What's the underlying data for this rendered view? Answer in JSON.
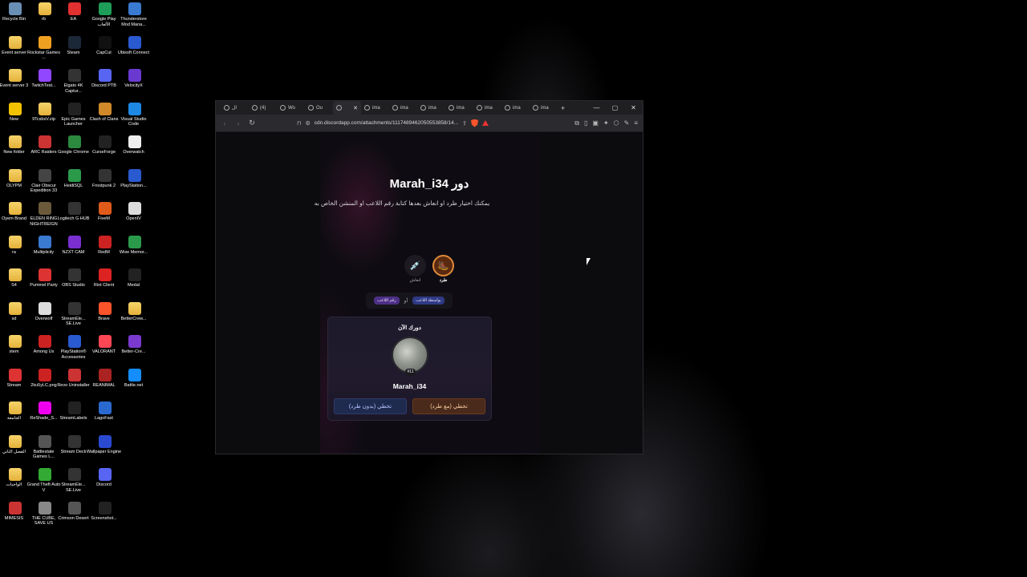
{
  "desktop": {
    "icons": [
      {
        "label": "Recycle Bin",
        "col": 0,
        "row": 0,
        "icon": "recycle-bin-icon",
        "color": "#6a8fb5"
      },
      {
        "label": "Event server",
        "col": 0,
        "row": 1,
        "icon": "folder-icon",
        "color": "folder"
      },
      {
        "label": "Event server 3",
        "col": 0,
        "row": 2,
        "icon": "folder-icon",
        "color": "folder"
      },
      {
        "label": "New",
        "col": 0,
        "row": 3,
        "icon": "warning-icon",
        "color": "#f2c200"
      },
      {
        "label": "New folder",
        "col": 0,
        "row": 4,
        "icon": "folder-icon",
        "color": "folder"
      },
      {
        "label": "OLYPM",
        "col": 0,
        "row": 5,
        "icon": "folder-icon",
        "color": "folder"
      },
      {
        "label": "Oyem Brand",
        "col": 0,
        "row": 6,
        "icon": "folder-icon",
        "color": "folder"
      },
      {
        "label": "ra",
        "col": 0,
        "row": 7,
        "icon": "folder-icon",
        "color": "folder"
      },
      {
        "label": "S4",
        "col": 0,
        "row": 8,
        "icon": "folder-icon",
        "color": "folder"
      },
      {
        "label": "sd",
        "col": 0,
        "row": 9,
        "icon": "folder-icon",
        "color": "folder"
      },
      {
        "label": "stem",
        "col": 0,
        "row": 10,
        "icon": "folder-icon",
        "color": "folder"
      },
      {
        "label": "Stream",
        "col": 0,
        "row": 11,
        "icon": "x-icon",
        "color": "#d33"
      },
      {
        "label": "الجامعة",
        "col": 0,
        "row": 12,
        "icon": "folder-icon",
        "color": "folder"
      },
      {
        "label": "الفصل الثاني",
        "col": 0,
        "row": 13,
        "icon": "folder-icon",
        "color": "folder"
      },
      {
        "label": "الواجبات",
        "col": 0,
        "row": 14,
        "icon": "folder-icon",
        "color": "folder"
      },
      {
        "label": "MIMESIS",
        "col": 0,
        "row": 15,
        "icon": "mimesis-icon",
        "color": "#c33"
      },
      {
        "label": "rb",
        "col": 1,
        "row": 0,
        "icon": "folder-icon",
        "color": "folder"
      },
      {
        "label": "Rockstar Games ...",
        "col": 1,
        "row": 1,
        "icon": "rockstar-icon",
        "color": "#f0a020"
      },
      {
        "label": "TwitchTest...",
        "col": 1,
        "row": 2,
        "icon": "twitch-icon",
        "color": "#9146ff"
      },
      {
        "label": "9TcsbsV.zip",
        "col": 1,
        "row": 3,
        "icon": "zip-folder-icon",
        "color": "folder"
      },
      {
        "label": "ARC Raiders",
        "col": 1,
        "row": 4,
        "icon": "arc-raiders-icon",
        "color": "#c33"
      },
      {
        "label": "Clair Obscur Expedition 33",
        "col": 1,
        "row": 5,
        "icon": "clair-obscur-icon",
        "color": "#444"
      },
      {
        "label": "ELDEN RING NIGHTREIGN",
        "col": 1,
        "row": 6,
        "icon": "elden-ring-icon",
        "color": "#6a5a3a"
      },
      {
        "label": "Multiplicity",
        "col": 1,
        "row": 7,
        "icon": "multiplicity-icon",
        "color": "#3a7ad0"
      },
      {
        "label": "Pummel Party",
        "col": 1,
        "row": 8,
        "icon": "pummel-party-icon",
        "color": "#d33"
      },
      {
        "label": "Overwolf",
        "col": 1,
        "row": 9,
        "icon": "overwolf-icon",
        "color": "#ddd"
      },
      {
        "label": "Among Us",
        "col": 1,
        "row": 10,
        "icon": "among-us-icon",
        "color": "#c22"
      },
      {
        "label": "2ku5yLC.png",
        "col": 1,
        "row": 11,
        "icon": "image-file-icon",
        "color": "#c22"
      },
      {
        "label": "ReShade_S...",
        "col": 1,
        "row": 12,
        "icon": "reshade-icon",
        "color": "#e0e"
      },
      {
        "label": "Battlestate Games L...",
        "col": 1,
        "row": 13,
        "icon": "battlestate-icon",
        "color": "#555"
      },
      {
        "label": "Grand Theft Auto V",
        "col": 1,
        "row": 14,
        "icon": "gta-icon",
        "color": "#3a3"
      },
      {
        "label": "THE CUBE, SAVE US",
        "col": 1,
        "row": 15,
        "icon": "the-cube-icon",
        "color": "#888"
      },
      {
        "label": "EA",
        "col": 2,
        "row": 0,
        "icon": "ea-icon",
        "color": "#e03030"
      },
      {
        "label": "Steam",
        "col": 2,
        "row": 1,
        "icon": "steam-icon",
        "color": "#1b2838"
      },
      {
        "label": "Elgato 4K Captur...",
        "col": 2,
        "row": 2,
        "icon": "elgato-icon",
        "color": "#333"
      },
      {
        "label": "Epic Games Launcher",
        "col": 2,
        "row": 3,
        "icon": "epic-games-icon",
        "color": "#222"
      },
      {
        "label": "Google Chrome",
        "col": 2,
        "row": 4,
        "icon": "chrome-icon",
        "color": "#2b8a3e"
      },
      {
        "label": "HeidiSQL",
        "col": 2,
        "row": 5,
        "icon": "heidisql-icon",
        "color": "#2a9a4a"
      },
      {
        "label": "Logitech G HUB",
        "col": 2,
        "row": 6,
        "icon": "logitech-icon",
        "color": "#333"
      },
      {
        "label": "NZXT CAM",
        "col": 2,
        "row": 7,
        "icon": "nzxt-icon",
        "color": "#7a2fd0"
      },
      {
        "label": "OBS Studio",
        "col": 2,
        "row": 8,
        "icon": "obs-icon",
        "color": "#333"
      },
      {
        "label": "StreamEle... SE.Live",
        "col": 2,
        "row": 9,
        "icon": "streamelements-icon",
        "color": "#333"
      },
      {
        "label": "PlayStation® Accessories",
        "col": 2,
        "row": 10,
        "icon": "playstation-icon",
        "color": "#2a5ad0"
      },
      {
        "label": "Revo Uninstaller",
        "col": 2,
        "row": 11,
        "icon": "revo-icon",
        "color": "#c33"
      },
      {
        "label": "StreamLabels",
        "col": 2,
        "row": 12,
        "icon": "streamlabels-icon",
        "color": "#222"
      },
      {
        "label": "Stream Deck",
        "col": 2,
        "row": 13,
        "icon": "stream-deck-icon",
        "color": "#333"
      },
      {
        "label": "StreamEle... SE.Live",
        "col": 2,
        "row": 14,
        "icon": "streamelements-icon",
        "color": "#333"
      },
      {
        "label": "Crimson Desert",
        "col": 2,
        "row": 15,
        "icon": "crimson-desert-icon",
        "color": "#555"
      },
      {
        "label": "Google Play الألعاب",
        "col": 3,
        "row": 0,
        "icon": "google-play-icon",
        "color": "#1e9e58"
      },
      {
        "label": "CapCut",
        "col": 3,
        "row": 1,
        "icon": "capcut-icon",
        "color": "#111"
      },
      {
        "label": "Discord PTB",
        "col": 3,
        "row": 2,
        "icon": "discord-icon",
        "color": "#5865f2"
      },
      {
        "label": "Clash of Clans",
        "col": 3,
        "row": 3,
        "icon": "clash-icon",
        "color": "#d08a2a"
      },
      {
        "label": "CurseForge",
        "col": 3,
        "row": 4,
        "icon": "curseforge-icon",
        "color": "#222"
      },
      {
        "label": "Frostpunk 2",
        "col": 3,
        "row": 5,
        "icon": "frostpunk-icon",
        "color": "#333"
      },
      {
        "label": "FiveM",
        "col": 3,
        "row": 6,
        "icon": "fivem-icon",
        "color": "#e05a1a"
      },
      {
        "label": "RedM",
        "col": 3,
        "row": 7,
        "icon": "redm-icon",
        "color": "#c22"
      },
      {
        "label": "Riot Client",
        "col": 3,
        "row": 8,
        "icon": "riot-icon",
        "color": "#d22"
      },
      {
        "label": "Brave",
        "col": 3,
        "row": 9,
        "icon": "brave-icon",
        "color": "#fb542b"
      },
      {
        "label": "VALORANT",
        "col": 3,
        "row": 10,
        "icon": "valorant-icon",
        "color": "#ff4655"
      },
      {
        "label": "REANIMAL",
        "col": 3,
        "row": 11,
        "icon": "reanimal-icon",
        "color": "#a22"
      },
      {
        "label": "LagoFast",
        "col": 3,
        "row": 12,
        "icon": "lagofast-icon",
        "color": "#2a6ad0"
      },
      {
        "label": "Wallpaper Engine",
        "col": 3,
        "row": 13,
        "icon": "wallpaper-engine-icon",
        "color": "#2a4ad0"
      },
      {
        "label": "Discord",
        "col": 3,
        "row": 14,
        "icon": "discord-icon",
        "color": "#5865f2"
      },
      {
        "label": "Screenshot...",
        "col": 3,
        "row": 15,
        "icon": "screenshot-file-icon",
        "color": "#222"
      },
      {
        "label": "Thunderstore Mod Mana...",
        "col": 4,
        "row": 0,
        "icon": "thunderstore-icon",
        "color": "#3a7ad0"
      },
      {
        "label": "Ubisoft Connect",
        "col": 4,
        "row": 1,
        "icon": "ubisoft-icon",
        "color": "#2a5ad0"
      },
      {
        "label": "VelocityX",
        "col": 4,
        "row": 2,
        "icon": "velocityx-icon",
        "color": "#6a3ad0"
      },
      {
        "label": "Visual Studio Code",
        "col": 4,
        "row": 3,
        "icon": "vscode-icon",
        "color": "#1e88e5"
      },
      {
        "label": "Overwatch",
        "col": 4,
        "row": 4,
        "icon": "overwatch-icon",
        "color": "#eee"
      },
      {
        "label": "PlayStation...",
        "col": 4,
        "row": 5,
        "icon": "playstation-icon",
        "color": "#2a5ad0"
      },
      {
        "label": "OpenIV",
        "col": 4,
        "row": 6,
        "icon": "openiv-icon",
        "color": "#ddd"
      },
      {
        "label": "Wise Memor...",
        "col": 4,
        "row": 7,
        "icon": "wise-memory-icon",
        "color": "#2a9a4a"
      },
      {
        "label": "Medal",
        "col": 4,
        "row": 8,
        "icon": "medal-icon",
        "color": "#222"
      },
      {
        "label": "BetterCrew...",
        "col": 4,
        "row": 9,
        "icon": "folder-icon",
        "color": "folder"
      },
      {
        "label": "Better-Cre...",
        "col": 4,
        "row": 10,
        "icon": "better-crewlink-icon",
        "color": "#7a3ad0"
      },
      {
        "label": "Battle.net",
        "col": 4,
        "row": 11,
        "icon": "battlenet-icon",
        "color": "#148eff"
      }
    ]
  },
  "browser": {
    "tabs": [
      {
        "label": "ال"
      },
      {
        "label": "(4)"
      },
      {
        "label": "Wo"
      },
      {
        "label": "Ou"
      },
      {
        "label": "",
        "active": true
      },
      {
        "label": "ima"
      },
      {
        "label": "ima"
      },
      {
        "label": "ima"
      },
      {
        "label": "ima"
      },
      {
        "label": "ima"
      },
      {
        "label": "ima"
      },
      {
        "label": "ima"
      }
    ],
    "new_tab": "+",
    "url": "cdn.discordapp.com/attachments/1117489462050553858/14...",
    "page": {
      "title": "دور Marah_i34",
      "description": "يمكنك اختيار طرد او انعاش بعدها كتابة رقم اللاعب او المنشن الخاص به",
      "modes": [
        {
          "label": "انعاش",
          "selected": false,
          "icon": "syringe-icon"
        },
        {
          "label": "طرد",
          "selected": true,
          "icon": "kick-icon"
        }
      ],
      "pill_mention": "بواسطة اللاعب",
      "pill_or": "أو",
      "pill_number": "رقم اللاعب",
      "card": {
        "heading": "دورك الآن",
        "badge": "#11",
        "player_name": "Marah_i34",
        "skip_no_kick": "تخطي (بدون طرد)",
        "skip_with_kick": "تخطي (مع طرد)"
      }
    }
  }
}
